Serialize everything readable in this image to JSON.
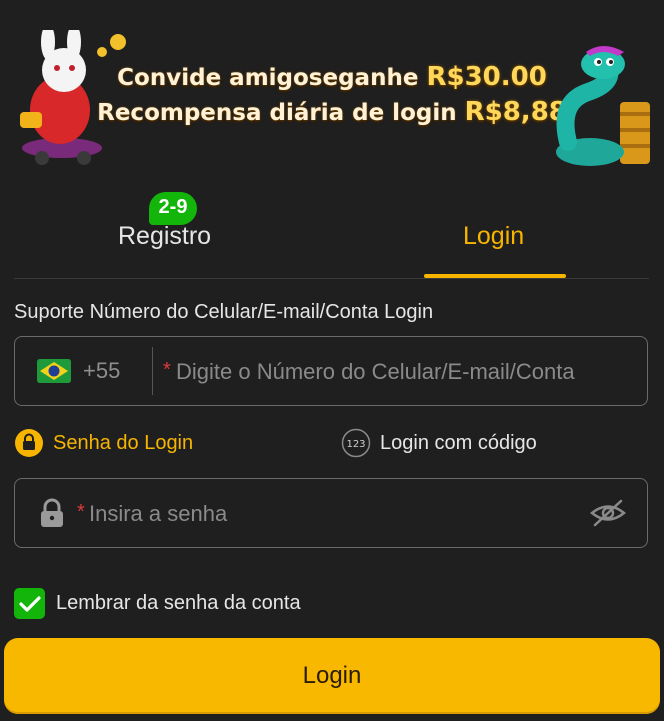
{
  "banner": {
    "line1_text": "Convide amigoseganhe",
    "line1_amount": "R$30.00",
    "line2_text": "Recompensa diária de login",
    "line2_amount": "R$8,88"
  },
  "tabs": {
    "register_label": "Registro",
    "register_badge": "2-9",
    "login_label": "Login",
    "active": "Login"
  },
  "account": {
    "hint": "Suporte Número do Celular/E-mail/Conta Login",
    "country_code": "+55",
    "required_mark": "*",
    "placeholder": "Digite o Número do Celular/E-mail/Conta",
    "value": ""
  },
  "login_options": {
    "password_label": "Senha do Login",
    "code_label": "Login com código",
    "code_icon_text": "123",
    "selected": "Senha do Login"
  },
  "password": {
    "required_mark": "*",
    "placeholder": "Insira a senha",
    "value": ""
  },
  "remember": {
    "label": "Lembrar da senha da conta",
    "checked": true
  },
  "submit": {
    "label": "Login"
  },
  "colors": {
    "accent": "#f7b500",
    "background": "#1f1f1f",
    "badge": "#13b50b",
    "required": "#e03a3a"
  },
  "icons": {
    "flag": "brazil-flag-icon",
    "lock_option": "lock-circle-icon",
    "code_option": "numeric-code-icon",
    "password_lock": "padlock-icon",
    "visibility": "eye-off-icon",
    "check": "checkmark-icon"
  }
}
